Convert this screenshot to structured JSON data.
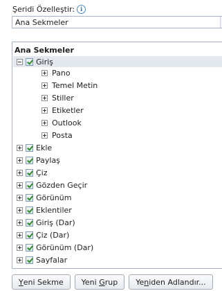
{
  "heading": {
    "label": "Şeridi Özelleştir:",
    "info_icon": "info-icon"
  },
  "tabs_dropdown": {
    "selected": "Ana Sekmeler"
  },
  "tree": {
    "header": "Ana Sekmeler",
    "items": [
      {
        "label": "Giriş",
        "level": 0,
        "expander": "expanded",
        "checked": true,
        "selected": true
      },
      {
        "label": "Pano",
        "level": 1,
        "expander": "collapsed"
      },
      {
        "label": "Temel Metin",
        "level": 1,
        "expander": "collapsed"
      },
      {
        "label": "Stiller",
        "level": 1,
        "expander": "collapsed"
      },
      {
        "label": "Etiketler",
        "level": 1,
        "expander": "collapsed"
      },
      {
        "label": "Outlook",
        "level": 1,
        "expander": "collapsed"
      },
      {
        "label": "Posta",
        "level": 1,
        "expander": "collapsed"
      },
      {
        "label": "Ekle",
        "level": 0,
        "expander": "collapsed",
        "checked": true
      },
      {
        "label": "Paylaş",
        "level": 0,
        "expander": "collapsed",
        "checked": true
      },
      {
        "label": "Çiz",
        "level": 0,
        "expander": "collapsed",
        "checked": true
      },
      {
        "label": "Gözden Geçir",
        "level": 0,
        "expander": "collapsed",
        "checked": true
      },
      {
        "label": "Görünüm",
        "level": 0,
        "expander": "collapsed",
        "checked": true
      },
      {
        "label": "Eklentiler",
        "level": 0,
        "expander": "collapsed",
        "checked": true
      },
      {
        "label": "Giriş (Dar)",
        "level": 0,
        "expander": "collapsed",
        "checked": true
      },
      {
        "label": "Çiz (Dar)",
        "level": 0,
        "expander": "collapsed",
        "checked": true
      },
      {
        "label": "Görünüm (Dar)",
        "level": 0,
        "expander": "collapsed",
        "checked": true
      },
      {
        "label": "Sayfalar",
        "level": 0,
        "expander": "collapsed",
        "checked": true
      }
    ]
  },
  "buttons": {
    "new_tab": {
      "mnemonic": "Y",
      "rest": "eni Sekme"
    },
    "new_group": {
      "prefix": "Yeni ",
      "mnemonic": "G",
      "rest": "rup"
    },
    "rename": {
      "prefix": "Ye",
      "mnemonic": "n",
      "rest": "iden Adlandır..."
    }
  }
}
